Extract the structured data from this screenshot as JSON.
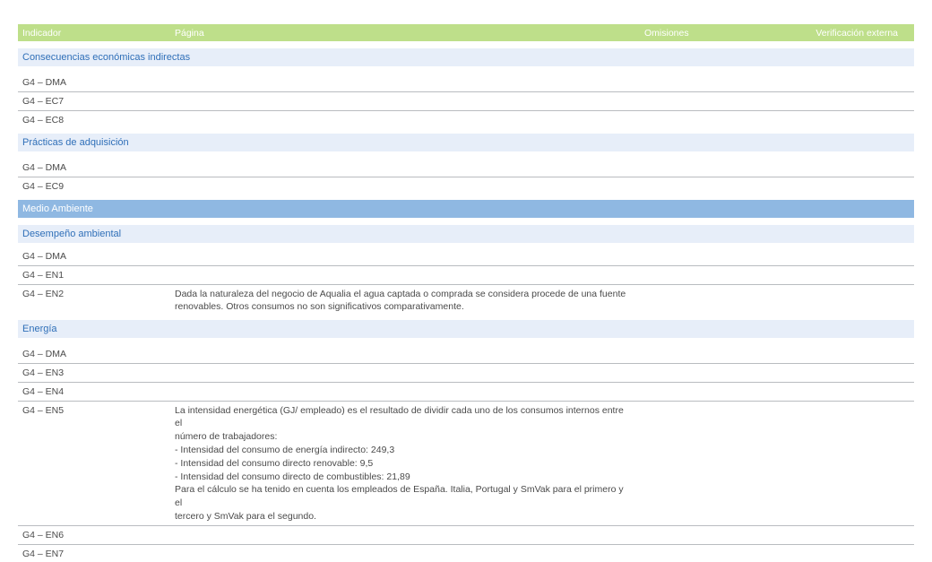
{
  "header": {
    "indicador": "Indicador",
    "pagina": "Página",
    "omisiones": "Omisiones",
    "verificacion": "Verificación externa"
  },
  "sections": {
    "s1": "Consecuencias económicas indirectas",
    "s2": "Prácticas de adquisición",
    "major": "Medio Ambiente",
    "s3": "Desempeño ambiental",
    "s4": "Energía"
  },
  "rows": {
    "r1": {
      "ind": "G4 – DMA",
      "pag": ""
    },
    "r2": {
      "ind": "G4 – EC7",
      "pag": ""
    },
    "r3": {
      "ind": "G4 – EC8",
      "pag": ""
    },
    "r4": {
      "ind": "G4 – DMA",
      "pag": ""
    },
    "r5": {
      "ind": "G4 – EC9",
      "pag": ""
    },
    "r6": {
      "ind": "G4 – DMA",
      "pag": ""
    },
    "r7": {
      "ind": "G4 – EN1",
      "pag": ""
    },
    "r8": {
      "ind": "G4 – EN2",
      "pag": "Dada la naturaleza del negocio de Aqualia el agua captada o comprada se considera procede de una fuente\nrenovables. Otros consumos no son significativos comparativamente."
    },
    "r9": {
      "ind": "G4 – DMA",
      "pag": ""
    },
    "r10": {
      "ind": "G4 – EN3",
      "pag": ""
    },
    "r11": {
      "ind": "G4 – EN4",
      "pag": ""
    },
    "r12": {
      "ind": "G4 – EN5",
      "pag": "La intensidad energética (GJ/ empleado) es el resultado de dividir cada uno de los consumos internos entre el\nnúmero de trabajadores:\n- Intensidad del consumo de energía indirecto: 249,3\n- Intensidad del consumo directo renovable: 9,5\n- Intensidad del consumo directo de combustibles: 21,89\nPara el cálculo se ha tenido en cuenta los empleados de España. Italia, Portugal y SmVak para el primero y el\ntercero y SmVak para el segundo."
    },
    "r13": {
      "ind": "G4 – EN6",
      "pag": ""
    },
    "r14": {
      "ind": "G4 – EN7",
      "pag": ""
    }
  }
}
